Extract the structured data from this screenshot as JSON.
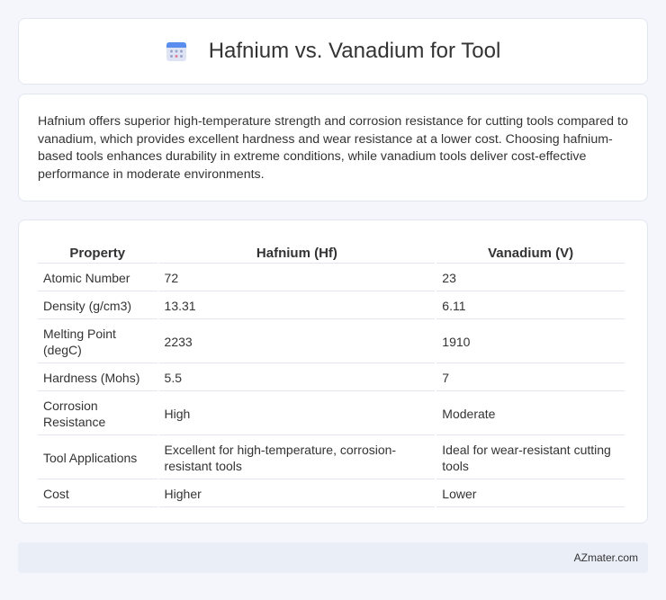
{
  "header": {
    "title": "Hafnium vs. Vanadium for Tool",
    "icon": "calendar-grid-icon"
  },
  "summary": {
    "text": "Hafnium offers superior high-temperature strength and corrosion resistance for cutting tools compared to vanadium, which provides excellent hardness and wear resistance at a lower cost. Choosing hafnium-based tools enhances durability in extreme conditions, while vanadium tools deliver cost-effective performance in moderate environments."
  },
  "table": {
    "headers": [
      "Property",
      "Hafnium (Hf)",
      "Vanadium (V)"
    ],
    "rows": [
      [
        "Atomic Number",
        "72",
        "23"
      ],
      [
        "Density (g/cm3)",
        "13.31",
        "6.11"
      ],
      [
        "Melting Point (degC)",
        "2233",
        "1910"
      ],
      [
        "Hardness (Mohs)",
        "5.5",
        "7"
      ],
      [
        "Corrosion Resistance",
        "High",
        "Moderate"
      ],
      [
        "Tool Applications",
        "Excellent for high-temperature, corrosion-resistant tools",
        "Ideal for wear-resistant cutting tools"
      ],
      [
        "Cost",
        "Higher",
        "Lower"
      ]
    ]
  },
  "footer": {
    "brand": "AZmater.com"
  }
}
